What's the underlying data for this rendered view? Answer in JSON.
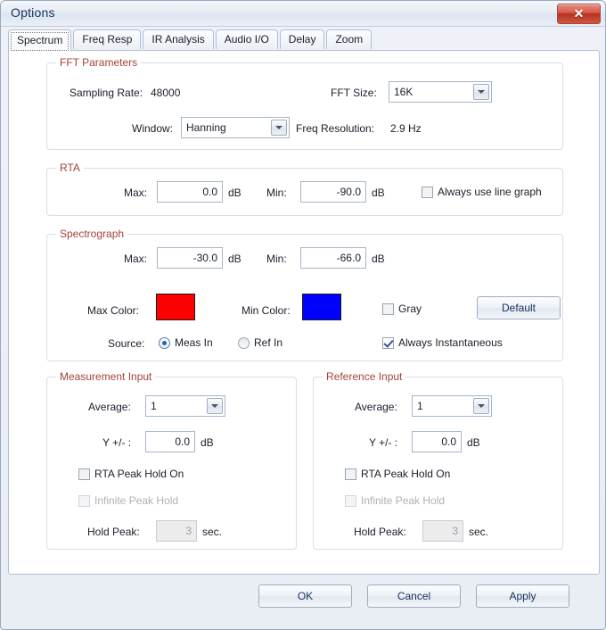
{
  "window": {
    "title": "Options",
    "close_label": "✕"
  },
  "tabs": [
    {
      "label": "Spectrum",
      "selected": true
    },
    {
      "label": "Freq Resp",
      "selected": false
    },
    {
      "label": "IR Analysis",
      "selected": false
    },
    {
      "label": "Audio I/O",
      "selected": false
    },
    {
      "label": "Delay",
      "selected": false
    },
    {
      "label": "Zoom",
      "selected": false
    }
  ],
  "fft_parameters": {
    "legend": "FFT Parameters",
    "sampling_rate_label": "Sampling Rate:",
    "sampling_rate_value": "48000",
    "fft_size_label": "FFT Size:",
    "fft_size_value": "16K",
    "window_label": "Window:",
    "window_value": "Hanning",
    "freq_resolution_label": "Freq Resolution:",
    "freq_resolution_value": "2.9 Hz"
  },
  "rta": {
    "legend": "RTA",
    "max_label": "Max:",
    "max_value": "0.0",
    "max_unit": "dB",
    "min_label": "Min:",
    "min_value": "-90.0",
    "min_unit": "dB",
    "line_graph_label": "Always use line graph",
    "line_graph_checked": false
  },
  "spectrograph": {
    "legend": "Spectrograph",
    "max_label": "Max:",
    "max_value": "-30.0",
    "max_unit": "dB",
    "min_label": "Min:",
    "min_value": "-66.0",
    "min_unit": "dB",
    "max_color_label": "Max Color:",
    "max_color": "#FF0000",
    "min_color_label": "Min Color:",
    "min_color": "#0000FF",
    "gray_label": "Gray",
    "gray_checked": false,
    "default_button": "Default",
    "source_label": "Source:",
    "source_meas_label": "Meas In",
    "source_ref_label": "Ref In",
    "source_selected": "Meas In",
    "always_instantaneous_label": "Always Instantaneous",
    "always_instantaneous_checked": true
  },
  "measurement_input": {
    "legend": "Measurement Input",
    "average_label": "Average:",
    "average_value": "1",
    "y_offset_label": "Y +/- :",
    "y_offset_value": "0.0",
    "y_offset_unit": "dB",
    "rta_peak_hold_label": "RTA Peak Hold On",
    "rta_peak_hold_checked": false,
    "infinite_peak_hold_label": "Infinite Peak Hold",
    "infinite_peak_hold_checked": false,
    "hold_peak_label": "Hold Peak:",
    "hold_peak_value": "3",
    "hold_peak_unit": "sec."
  },
  "reference_input": {
    "legend": "Reference Input",
    "average_label": "Average:",
    "average_value": "1",
    "y_offset_label": "Y +/- :",
    "y_offset_value": "0.0",
    "y_offset_unit": "dB",
    "rta_peak_hold_label": "RTA Peak Hold On",
    "rta_peak_hold_checked": false,
    "infinite_peak_hold_label": "Infinite Peak Hold",
    "infinite_peak_hold_checked": false,
    "hold_peak_label": "Hold Peak:",
    "hold_peak_value": "3",
    "hold_peak_unit": "sec."
  },
  "footer": {
    "ok_label": "OK",
    "cancel_label": "Cancel",
    "apply_label": "Apply"
  }
}
